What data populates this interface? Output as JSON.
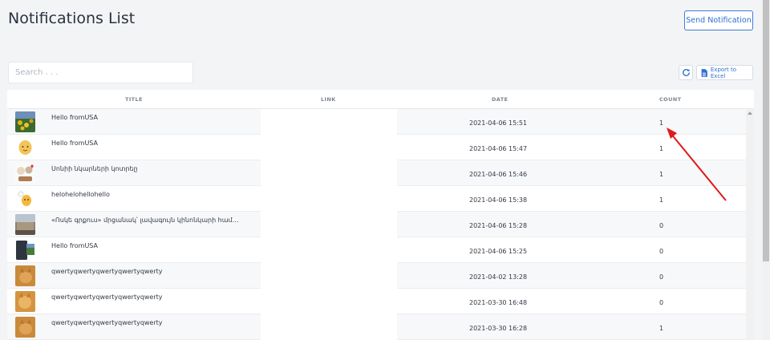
{
  "page": {
    "title": "Notifications List",
    "send_button": "Send Notification"
  },
  "search": {
    "placeholder": "Search . . ."
  },
  "toolbar": {
    "refresh_icon": "refresh-icon",
    "export_icon": "excel-file-icon",
    "export_label": "Export to Excel"
  },
  "table": {
    "columns": [
      "TITLE",
      "LINK",
      "DATE",
      "COUNT"
    ],
    "rows": [
      {
        "thumb": "garden-photo",
        "title": "Hello fromUSA",
        "link": "",
        "date": "2021-04-06 15:51",
        "count": "1"
      },
      {
        "thumb": "cartoon-character",
        "title": "Hello fromUSA",
        "link": "",
        "date": "2021-04-06 15:47",
        "count": "1"
      },
      {
        "thumb": "stickers",
        "title": "Սոնիի նկարների կոտրեը",
        "link": "",
        "date": "2021-04-06 15:46",
        "count": "1"
      },
      {
        "thumb": "cartoon-character-small",
        "title": "helohelohellohello",
        "link": "",
        "date": "2021-04-06 15:38",
        "count": "1"
      },
      {
        "thumb": "building-photo",
        "title": "«Ոսկե գրքուս» մրցանակ՝ լավագույն կինոնկարի համ…",
        "link": "",
        "date": "2021-04-06 15:28",
        "count": "0"
      },
      {
        "thumb": "phone-photo",
        "title": "Hello fromUSA",
        "link": "",
        "date": "2021-04-06 15:25",
        "count": "0"
      },
      {
        "thumb": "cat-photo",
        "title": "qwertyqwertyqwertyqwertyqwerty",
        "link": "",
        "date": "2021-04-02 13:28",
        "count": "0"
      },
      {
        "thumb": "cat-photo",
        "title": "qwertyqwertyqwertyqwertyqwerty",
        "link": "",
        "date": "2021-03-30 16:48",
        "count": "0"
      },
      {
        "thumb": "cat-photo",
        "title": "qwertyqwertyqwertyqwertyqwerty",
        "link": "",
        "date": "2021-03-30 16:28",
        "count": "1"
      }
    ]
  },
  "colors": {
    "accent": "#2f6fd1",
    "annotation_arrow": "#e0191b"
  }
}
